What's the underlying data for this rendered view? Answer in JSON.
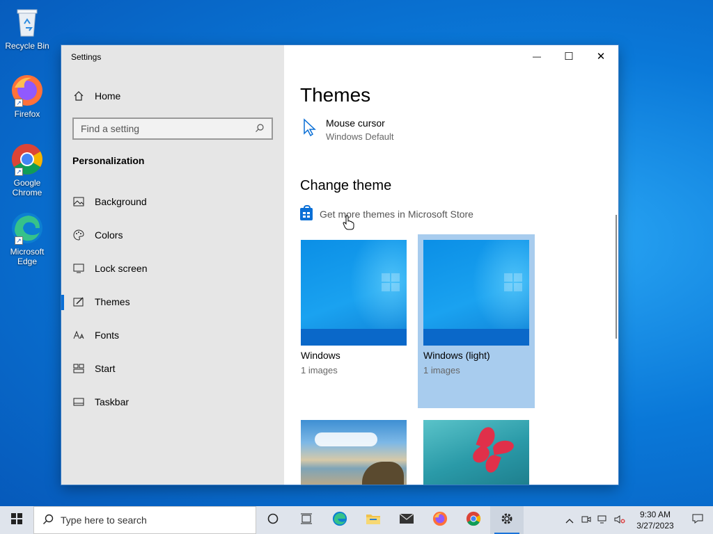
{
  "desktop": {
    "icons": [
      {
        "label": "Recycle Bin"
      },
      {
        "label": "Firefox"
      },
      {
        "label": "Google Chrome"
      },
      {
        "label": "Microsoft Edge"
      }
    ]
  },
  "window": {
    "title": "Settings",
    "controls": {
      "minimize": "—",
      "maximize": "☐",
      "close": "✕"
    }
  },
  "sidebar": {
    "home_label": "Home",
    "search_placeholder": "Find a setting",
    "section": "Personalization",
    "items": [
      {
        "label": "Background",
        "icon": "picture-icon"
      },
      {
        "label": "Colors",
        "icon": "palette-icon"
      },
      {
        "label": "Lock screen",
        "icon": "lock-screen-icon"
      },
      {
        "label": "Themes",
        "icon": "themes-icon",
        "active": true
      },
      {
        "label": "Fonts",
        "icon": "fonts-icon"
      },
      {
        "label": "Start",
        "icon": "start-icon"
      },
      {
        "label": "Taskbar",
        "icon": "taskbar-icon"
      }
    ]
  },
  "main": {
    "page_title": "Themes",
    "mouse_cursor": {
      "title": "Mouse cursor",
      "value": "Windows Default"
    },
    "change_theme_title": "Change theme",
    "store_link": "Get more themes in Microsoft Store",
    "themes": [
      {
        "name": "Windows",
        "count": "1 images",
        "selected": false
      },
      {
        "name": "Windows (light)",
        "count": "1 images",
        "selected": true
      }
    ]
  },
  "taskbar": {
    "search_placeholder": "Type here to search",
    "time": "9:30 AM",
    "date": "3/27/2023",
    "accent": "#1a73d9"
  }
}
